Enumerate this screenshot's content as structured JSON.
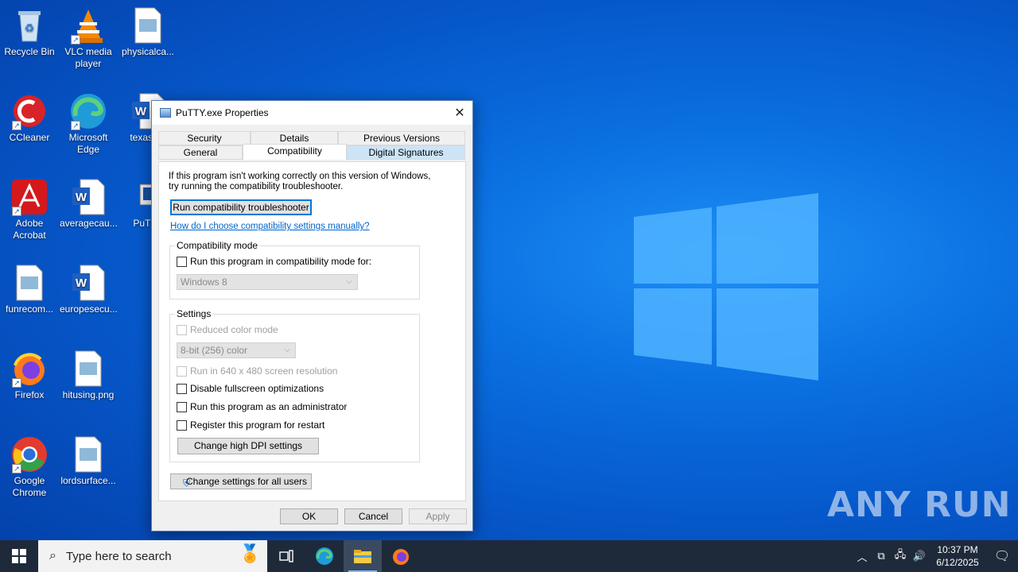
{
  "desktop": {
    "icons": [
      {
        "label": "Recycle Bin",
        "icon": "recycle-bin-icon"
      },
      {
        "label": "VLC media player",
        "icon": "vlc-icon"
      },
      {
        "label": "physicalca...",
        "icon": "image-file-icon"
      },
      {
        "label": "CCleaner",
        "icon": "ccleaner-icon"
      },
      {
        "label": "Microsoft Edge",
        "icon": "edge-icon"
      },
      {
        "label": "texasb...",
        "icon": "word-doc-icon"
      },
      {
        "label": "Adobe Acrobat",
        "icon": "acrobat-icon"
      },
      {
        "label": "averagecau...",
        "icon": "word-doc-icon"
      },
      {
        "label": "PuTTY",
        "icon": "putty-icon"
      },
      {
        "label": "funrecom...",
        "icon": "image-file-icon"
      },
      {
        "label": "europesecu...",
        "icon": "word-doc-icon"
      },
      {
        "label": "Firefox",
        "icon": "firefox-icon"
      },
      {
        "label": "hitusing.png",
        "icon": "image-file-icon"
      },
      {
        "label": "Google Chrome",
        "icon": "chrome-icon"
      },
      {
        "label": "lordsurface...",
        "icon": "image-file-icon"
      }
    ]
  },
  "dialog": {
    "title": "PuTTY.exe Properties",
    "tabs_row1": [
      "Security",
      "Details",
      "Previous Versions"
    ],
    "tabs_row2": [
      "General",
      "Compatibility",
      "Digital Signatures"
    ],
    "intro_line1": "If this program isn't working correctly on this version of Windows,",
    "intro_line2": "try running the compatibility troubleshooter.",
    "run_troubleshooter": "Run compatibility troubleshooter",
    "help_link": "How do I choose compatibility settings manually?",
    "compat_group": "Compatibility mode",
    "compat_checkbox": "Run this program in compatibility mode for:",
    "compat_select": "Windows 8",
    "settings_group": "Settings",
    "reduced_color": "Reduced color mode",
    "color_select": "8-bit (256) color",
    "res_640": "Run in 640 x 480 screen resolution",
    "disable_fullscreen": "Disable fullscreen optimizations",
    "run_admin": "Run this program as an administrator",
    "register_restart": "Register this program for restart",
    "change_dpi": "Change high DPI settings",
    "change_all_users": "Change settings for all users",
    "ok": "OK",
    "cancel": "Cancel",
    "apply": "Apply"
  },
  "taskbar": {
    "search_placeholder": "Type here to search",
    "time": "10:37 PM",
    "date": "6/12/2025"
  },
  "watermark": "ANY RUN",
  "colors": {
    "accent": "#0078d7",
    "desktop": "#0a6fe0",
    "taskbar": "#1e2a3a"
  }
}
